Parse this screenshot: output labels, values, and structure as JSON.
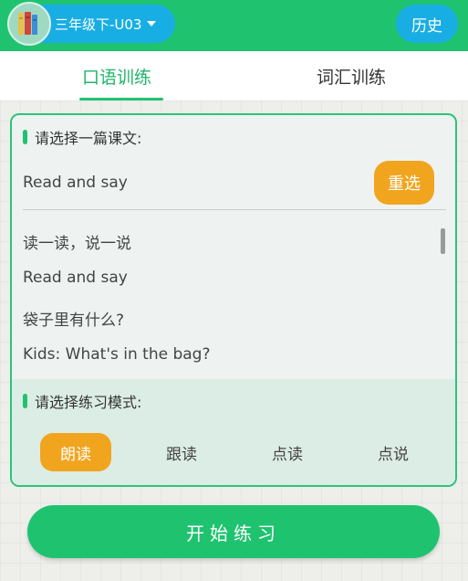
{
  "header": {
    "grade_selector": "三年级下-U03",
    "history_label": "历史",
    "avatar_icon": "books-icon"
  },
  "tabs": [
    {
      "label": "口语训练",
      "active": true
    },
    {
      "label": "词汇训练",
      "active": false
    }
  ],
  "lesson_section": {
    "heading": "请选择一篇课文:",
    "selected_value": "Read and say",
    "reselect_label": "重选",
    "items": [
      "读一读，说一说",
      "Read and say",
      "袋子里有什么?",
      "Kids: What's in the bag?"
    ]
  },
  "mode_section": {
    "heading": "请选择练习模式:",
    "modes": [
      {
        "label": "朗读",
        "active": true
      },
      {
        "label": "跟读",
        "active": false
      },
      {
        "label": "点读",
        "active": false
      },
      {
        "label": "点说",
        "active": false
      }
    ]
  },
  "start_label": "开始练习",
  "colors": {
    "primary_green": "#1fc36f",
    "header_blue": "#19aee3",
    "accent_orange": "#f1a51f"
  }
}
